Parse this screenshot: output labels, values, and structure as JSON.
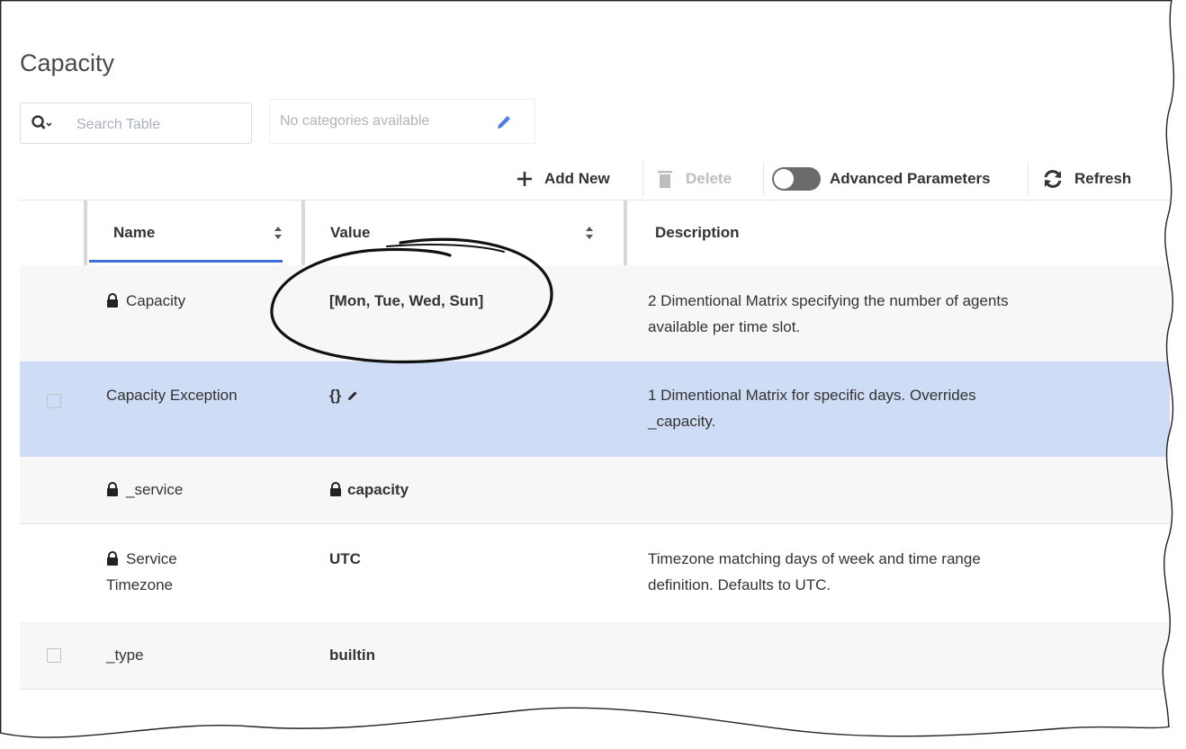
{
  "page": {
    "title": "Capacity"
  },
  "search": {
    "placeholder": "Search Table"
  },
  "categories": {
    "label": "No categories available"
  },
  "toolbar": {
    "add_label": "Add New",
    "delete_label": "Delete",
    "advanced_label": "Advanced Parameters",
    "refresh_label": "Refresh"
  },
  "table": {
    "columns": [
      "Name",
      "Value",
      "Description"
    ],
    "rows": [
      {
        "name": "Capacity",
        "locked": true,
        "checkbox": false,
        "value": "[Mon, Tue, Wed, Sun]",
        "value_bold": true,
        "description_1": "2 Dimentional Matrix specifying the number of agents",
        "description_2": "available per time slot."
      },
      {
        "name": "Capacity Exception",
        "locked": false,
        "checkbox": true,
        "selected": true,
        "value": "{}",
        "value_bold": true,
        "description_1": "1 Dimentional Matrix for specific days. Overrides",
        "description_2": "_capacity."
      },
      {
        "name": "_service",
        "locked": true,
        "checkbox": false,
        "value": "capacity",
        "value_locked": true,
        "description_1": "",
        "description_2": ""
      },
      {
        "name_1": "Service",
        "name_2": "Timezone",
        "locked": true,
        "checkbox": false,
        "value": "UTC",
        "description_1": "Timezone matching days of week and time range",
        "description_2": "definition. Defaults to UTC."
      },
      {
        "name": "_type",
        "locked": false,
        "checkbox": true,
        "value": "builtin",
        "description_1": "",
        "description_2": ""
      }
    ]
  },
  "colors": {
    "selected_row": "#cfdcf5",
    "accent": "#3b6fd6",
    "toggle": "#6b6b6b"
  }
}
